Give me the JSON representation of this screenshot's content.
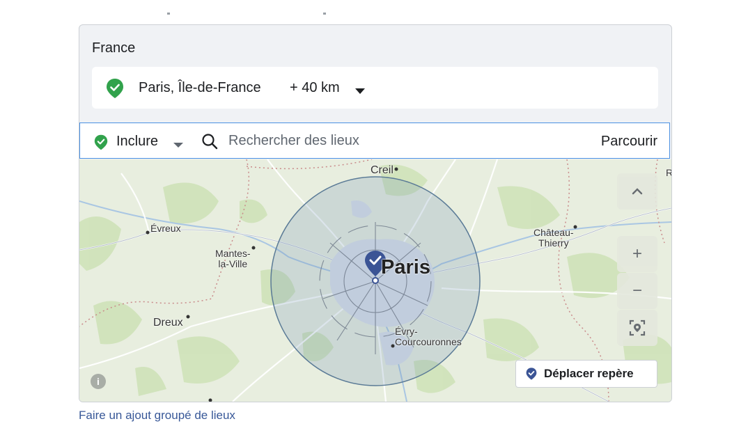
{
  "location": {
    "country": "France",
    "selected_location": "Paris, Île-de-France",
    "radius": "+ 40 km"
  },
  "search": {
    "mode": "Inclure",
    "placeholder": "Rechercher des lieux",
    "browse_label": "Parcourir"
  },
  "map": {
    "labels": {
      "paris": "Paris",
      "creil": "Creil",
      "evreux": "Évreux",
      "mantes": "Mantes-\nla-Ville",
      "chateau": "Château-\nThierry",
      "dreux": "Dreux",
      "evry": "Évry-\nCourcouronnes",
      "edge_r": "R"
    },
    "controls": {
      "zoom_in": "+",
      "zoom_out": "−"
    },
    "move_marker_label": "Déplacer repère",
    "info_glyph": "i"
  },
  "bulk_add_link": "Faire un ajout groupé de lieux",
  "colors": {
    "include_green": "#31a24c",
    "pin_blue": "#3b5495",
    "link_blue": "#385898"
  },
  "icons": {
    "location_pin": "check-shield-icon",
    "search": "search-icon",
    "caret": "caret-down-icon",
    "recenter": "recenter-icon",
    "info": "info-icon"
  }
}
